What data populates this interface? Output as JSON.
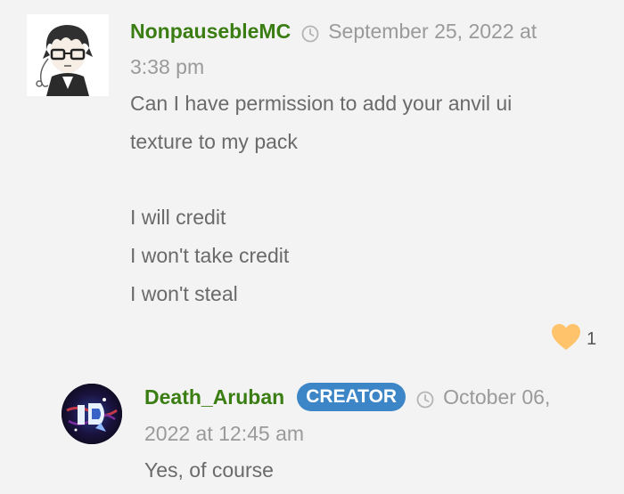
{
  "comment": {
    "author": "NonpausebleMC",
    "date_line1": "September 25, 2022 at",
    "date_line2": "3:38 pm",
    "lines": [
      "Can I have permission to add your anvil ui",
      "texture to my pack",
      "I will credit",
      "I won't take credit",
      "I won't steal"
    ],
    "like_count": "1",
    "heart_color": "#ffc46b",
    "author_color": "#3a7d13"
  },
  "reply": {
    "author": "Death_Aruban",
    "badge": "CREATOR",
    "badge_color": "#3c85c6",
    "date_line1": "October 06,",
    "date_line2": "2022 at 12:45 am",
    "text": "Yes, of course"
  }
}
